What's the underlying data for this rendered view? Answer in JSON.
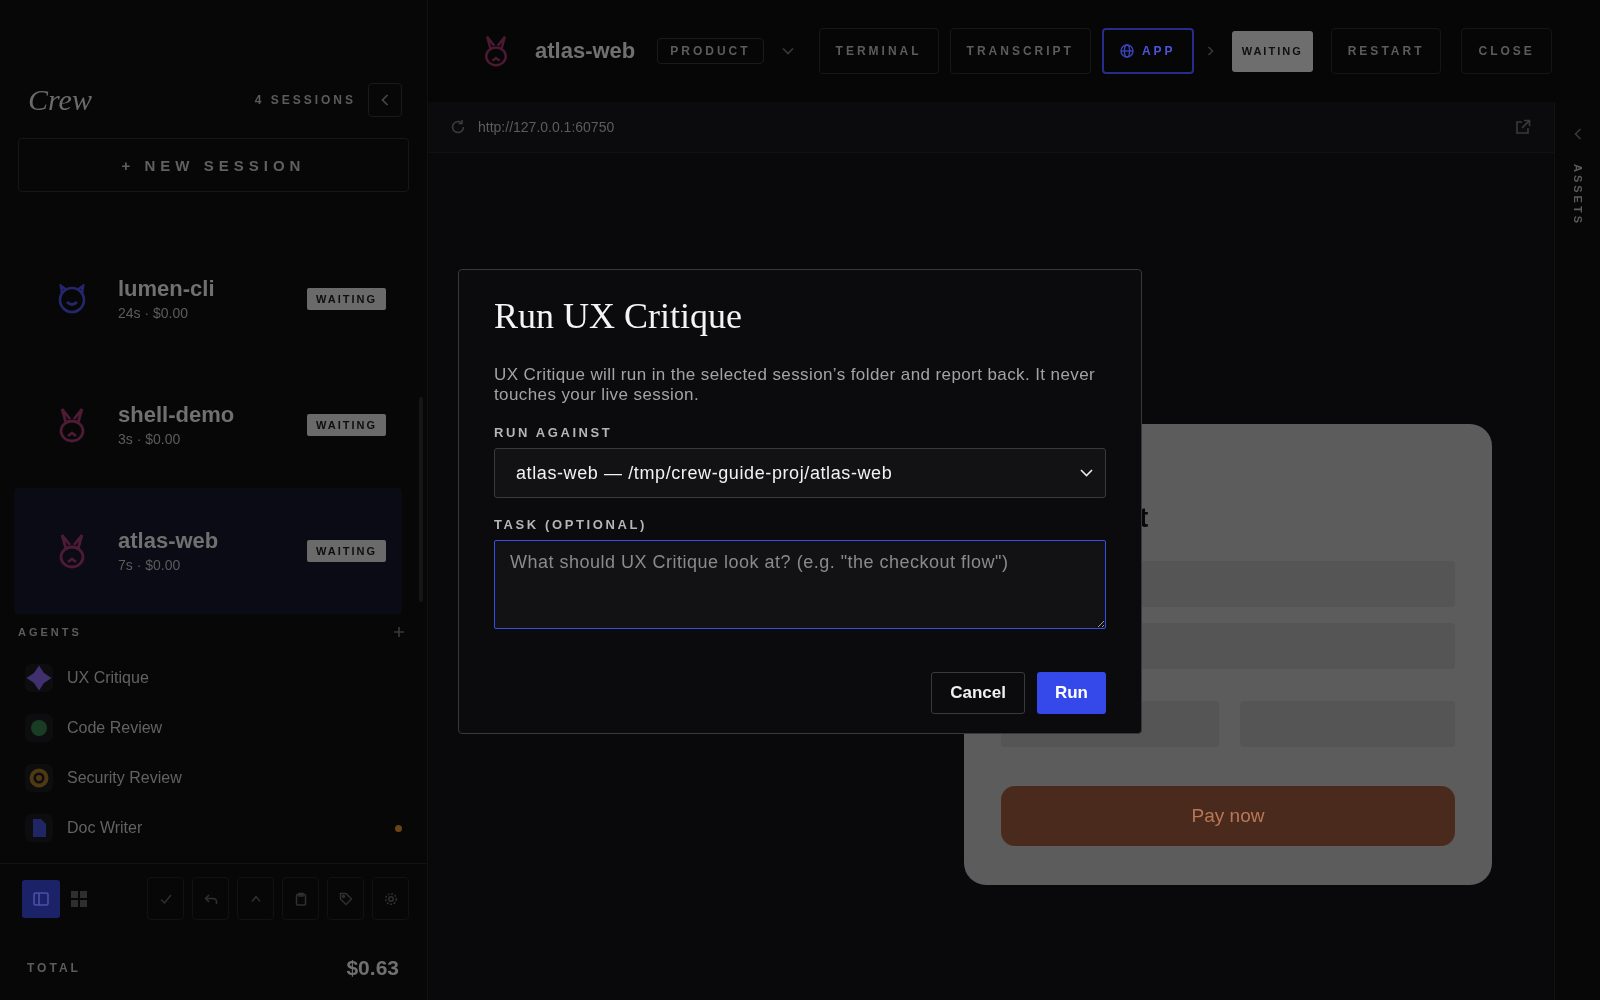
{
  "sidebar": {
    "brand": "Crew",
    "session_count": "4 SESSIONS",
    "new_session": "+ NEW SESSION",
    "sessions": [
      {
        "name": "lumen-cli",
        "meta": "24s · $0.00",
        "status": "WAITING",
        "kind": "cat",
        "color": "#26266e",
        "selected": false
      },
      {
        "name": "shell-demo",
        "meta": "3s · $0.00",
        "status": "WAITING",
        "kind": "rabbit",
        "color": "#4d1b34",
        "selected": false
      },
      {
        "name": "atlas-web",
        "meta": "7s · $0.00",
        "status": "WAITING",
        "kind": "rabbit",
        "color": "#4d1b34",
        "selected": true
      }
    ],
    "agents_title": "AGENTS",
    "agents": [
      {
        "name": "UX Critique",
        "kind": "sparkle",
        "color": "#40306e",
        "notification": false
      },
      {
        "name": "Code Review",
        "kind": "circle",
        "color": "#183d24",
        "notification": false
      },
      {
        "name": "Security Review",
        "kind": "ring",
        "color": "#4d3912",
        "notification": false
      },
      {
        "name": "Doc Writer",
        "kind": "document",
        "color": "#202566",
        "notification": true
      }
    ],
    "view_modes": [
      {
        "kind": "panel",
        "selected": true
      },
      {
        "kind": "grid",
        "selected": false
      }
    ],
    "total_label": "TOTAL",
    "total": "$0.63"
  },
  "header": {
    "title": "atlas-web",
    "project": "PRODUCT",
    "tabs": [
      {
        "label": "TERMINAL",
        "kind": "terminal",
        "selected": false
      },
      {
        "label": "TRANSCRIPT",
        "kind": "transcript",
        "selected": false
      },
      {
        "label": "APP",
        "kind": "app",
        "selected": true
      }
    ],
    "status": "WAITING",
    "actions": [
      "RESTART",
      "CLOSE"
    ]
  },
  "browser": {
    "url": "http://127.0.0.1:60750"
  },
  "preview": {
    "heading": "t",
    "button": "Pay now"
  },
  "assets_rail": {
    "label": "ASSETS"
  },
  "dialog": {
    "title": "Run UX Critique",
    "description": "UX Critique will run in the selected session’s folder and report back. It never touches your live session.",
    "target": {
      "label": "RUN AGAINST",
      "value": "atlas-web — /tmp/crew-guide-proj/atlas-web"
    },
    "task": {
      "label": "TASK (OPTIONAL)",
      "placeholder": "What should UX Critique look at? (e.g. \"the checkout flow\")"
    },
    "buttons": [
      {
        "label": "Cancel",
        "kind": "secondary"
      },
      {
        "label": "Run",
        "kind": "primary"
      }
    ]
  }
}
